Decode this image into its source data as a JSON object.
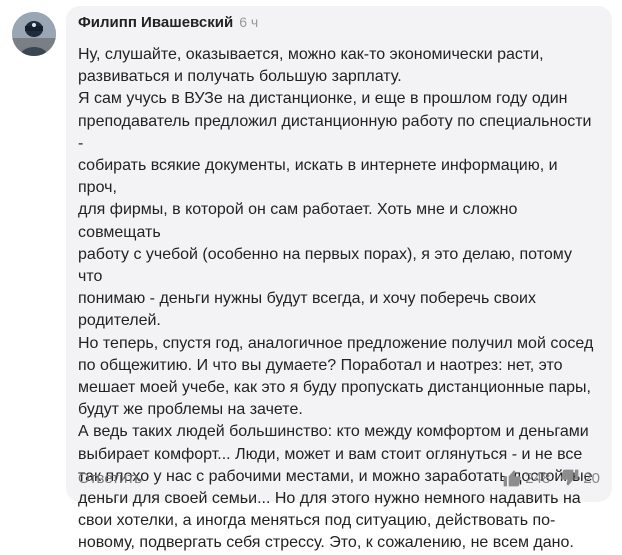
{
  "comment": {
    "author": "Филипп Ивашевский",
    "time": "6 ч",
    "text": "Ну, слушайте, оказывается, можно как-то экономически расти,\nразвиваться и получать большую зарплату.\nЯ сам учусь в ВУЗе на дистанционке, и еще в прошлом году один\nпреподаватель предложил дистанционную работу по специальности -\nсобирать всякие документы, искать в интернете информацию, и проч,\nдля фирмы, в которой он сам работает. Хоть мне и сложно совмещать\nработу с учебой (особенно на первых порах), я это делаю, потому что\nпонимаю - деньги нужны будут всегда, и хочу поберечь своих\nродителей.\nНо теперь, спустя год, аналогичное предложение получил мой сосед\nпо общежитию. И что вы думаете? Поработал и наотрез: нет, это\nмешает моей учебе, как это я буду пропускать дистанционные пары,\nбудут же проблемы на зачете.\nА ведь таких людей большинство: кто между комфортом и деньгами\nвыбирает комфорт... Люди, может и вам стоит оглянуться - и не все\nтак плохо у нас с рабочими местами, и можно заработать достойные\nденьги для своей семьи... Но для этого нужно немного надавить на\nсвои хотелки, а иногда меняться под ситуацию, действовать по-\nновому, подвергать себя стрессу. Это, к сожалению, не всем дано.",
    "reply_label": "Ответить",
    "likes": "248",
    "dislikes": "20",
    "icons": {
      "avatar": "user-avatar",
      "like": "thumbs-up-icon",
      "dislike": "thumbs-down-icon"
    },
    "colors": {
      "bubble": "#f3f3f5",
      "muted": "#888888"
    }
  }
}
